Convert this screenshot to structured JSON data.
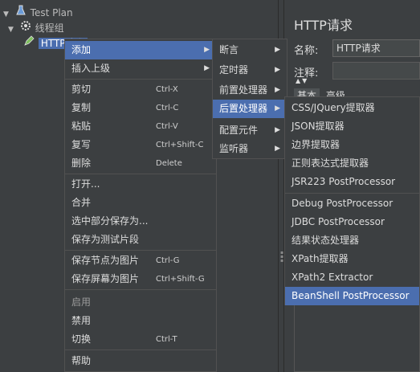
{
  "tree": {
    "items": [
      {
        "label": "Test Plan",
        "icon": "flask-icon"
      },
      {
        "label": "线程组",
        "icon": "gear-icon"
      },
      {
        "label": "HTTP请求",
        "icon": "pencil-icon"
      }
    ]
  },
  "panel": {
    "title": "HTTP请求",
    "name_label": "名称:",
    "name_value": "HTTP请求",
    "comment_label": "注释:",
    "tabs": [
      "基本",
      "高级"
    ]
  },
  "context_menu": {
    "items": [
      {
        "label": "添加",
        "shortcut": "",
        "submenu": true
      },
      {
        "label": "插入上级",
        "shortcut": "",
        "submenu": true
      },
      {
        "label": "剪切",
        "shortcut": "Ctrl-X"
      },
      {
        "label": "复制",
        "shortcut": "Ctrl-C"
      },
      {
        "label": "粘贴",
        "shortcut": "Ctrl-V"
      },
      {
        "label": "复写",
        "shortcut": "Ctrl+Shift-C"
      },
      {
        "label": "删除",
        "shortcut": "Delete"
      },
      {
        "label": "打开...",
        "shortcut": ""
      },
      {
        "label": "合并",
        "shortcut": ""
      },
      {
        "label": "选中部分保存为...",
        "shortcut": ""
      },
      {
        "label": "保存为测试片段",
        "shortcut": ""
      },
      {
        "label": "保存节点为图片",
        "shortcut": "Ctrl-G"
      },
      {
        "label": "保存屏幕为图片",
        "shortcut": "Ctrl+Shift-G"
      },
      {
        "label": "启用",
        "shortcut": ""
      },
      {
        "label": "禁用",
        "shortcut": ""
      },
      {
        "label": "切换",
        "shortcut": "Ctrl-T"
      },
      {
        "label": "帮助",
        "shortcut": ""
      }
    ]
  },
  "add_menu": {
    "items": [
      "断言",
      "定时器",
      "前置处理器",
      "后置处理器",
      "配置元件",
      "监听器"
    ]
  },
  "post_processor_menu": {
    "items": [
      "CSS/JQuery提取器",
      "JSON提取器",
      "边界提取器",
      "正则表达式提取器",
      "JSR223 PostProcessor",
      "Debug PostProcessor",
      "JDBC PostProcessor",
      "结果状态处理器",
      "XPath提取器",
      "XPath2 Extractor",
      "BeanShell PostProcessor"
    ]
  },
  "colors": {
    "background": "#3c3f41",
    "selection": "#4b6eaf",
    "text": "#dddddd"
  }
}
